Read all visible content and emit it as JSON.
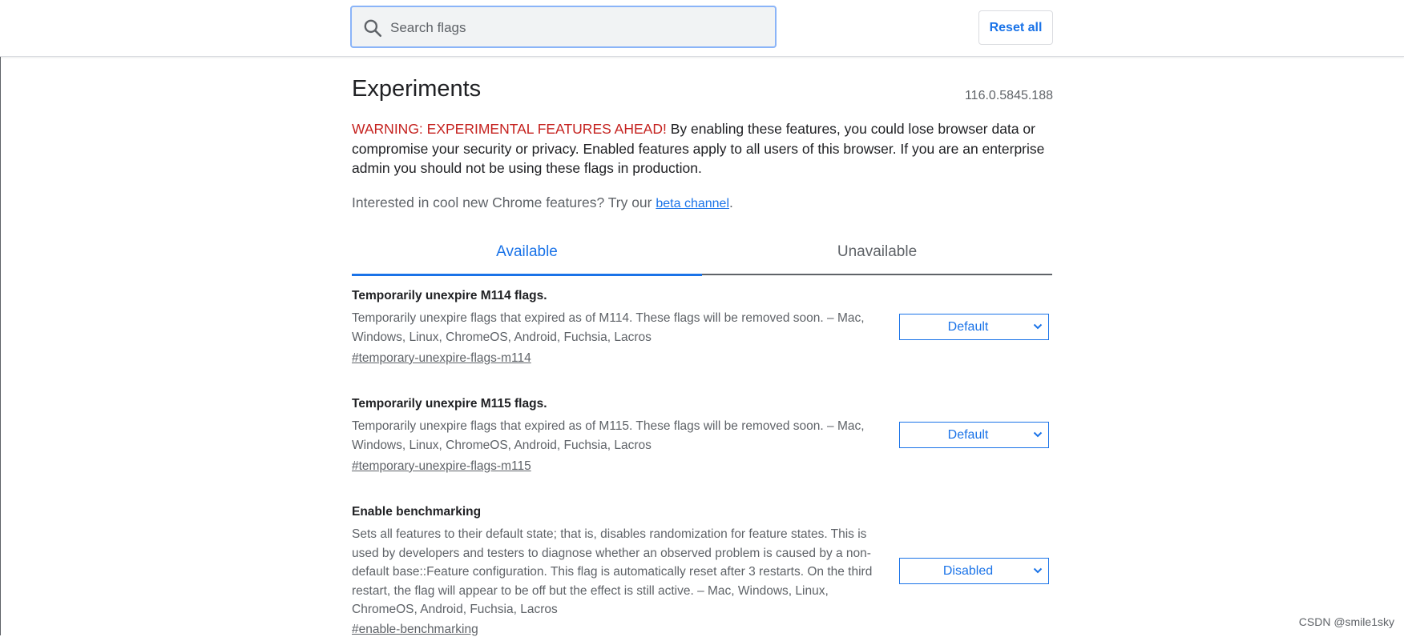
{
  "search": {
    "placeholder": "Search flags",
    "value": ""
  },
  "header": {
    "reset_label": "Reset all"
  },
  "page": {
    "title": "Experiments",
    "version": "116.0.5845.188",
    "warning_prefix": "WARNING: EXPERIMENTAL FEATURES AHEAD!",
    "warning_body": " By enabling these features, you could lose browser data or compromise your security or privacy. Enabled features apply to all users of this browser. If you are an enterprise admin you should not be using these flags in production.",
    "interest_text": "Interested in cool new Chrome features? Try our ",
    "beta_link": "beta channel",
    "interest_end": "."
  },
  "tabs": [
    {
      "label": "Available",
      "active": true
    },
    {
      "label": "Unavailable",
      "active": false
    }
  ],
  "flags": [
    {
      "name": "Temporarily unexpire M114 flags.",
      "description": "Temporarily unexpire flags that expired as of M114. These flags will be removed soon. – Mac, Windows, Linux, ChromeOS, Android, Fuchsia, Lacros",
      "link": "#temporary-unexpire-flags-m114",
      "value": "Default"
    },
    {
      "name": "Temporarily unexpire M115 flags.",
      "description": "Temporarily unexpire flags that expired as of M115. These flags will be removed soon. – Mac, Windows, Linux, ChromeOS, Android, Fuchsia, Lacros",
      "link": "#temporary-unexpire-flags-m115",
      "value": "Default"
    },
    {
      "name": "Enable benchmarking",
      "description": "Sets all features to their default state; that is, disables randomization for feature states. This is used by developers and testers to diagnose whether an observed problem is caused by a non-default base::Feature configuration. This flag is automatically reset after 3 restarts. On the third restart, the flag will appear to be off but the effect is still active. – Mac, Windows, Linux, ChromeOS, Android, Fuchsia, Lacros",
      "link": "#enable-benchmarking",
      "value": "Disabled"
    }
  ],
  "watermark": "CSDN @smile1sky",
  "colors": {
    "accent": "#1a73e8",
    "warning": "#c5221f",
    "secondary_text": "#5f6368"
  }
}
